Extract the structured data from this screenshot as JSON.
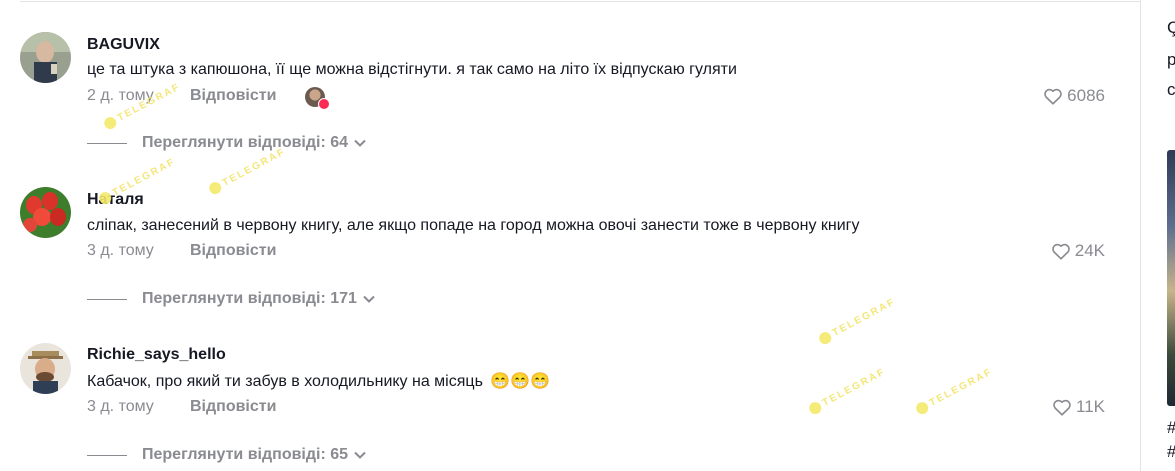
{
  "comments": [
    {
      "username": "BAGUVIX",
      "text": "це та штука з капюшона, її ще можна відстігнути. я так само на літо їх відпускаю гуляти",
      "emojis": "",
      "time": "2 д. тому",
      "reply_label": "Відповісти",
      "likes": "6086",
      "view_replies": "Переглянути відповіді: 64",
      "author_liked": true
    },
    {
      "username": "Наталя",
      "text": "сліпак, занесений в червону книгу, але якщо попаде на город можна овочі занести тоже в червону книгу",
      "emojis": "",
      "time": "3 д. тому",
      "reply_label": "Відповісти",
      "likes": "24K",
      "view_replies": "Переглянути відповіді: 171",
      "author_liked": false
    },
    {
      "username": "Richie_says_hello",
      "text": "Кабачок, про який ти забув в холодильнику на місяць",
      "emojis": "😁😁😁",
      "time": "3 д. тому",
      "reply_label": "Відповісти",
      "likes": "11K",
      "view_replies": "Переглянути відповіді: 65",
      "author_liked": false
    }
  ],
  "right_strip": {
    "chars": [
      "Ç",
      "p",
      "c",
      "#",
      "#"
    ]
  },
  "watermark": "TELEGRAF",
  "colors": {
    "accent": "#fe2c55",
    "muted": "#8a8b91",
    "text": "#161823"
  },
  "icons": {
    "like": "heart-outline-icon",
    "expand": "chevron-down-icon"
  }
}
